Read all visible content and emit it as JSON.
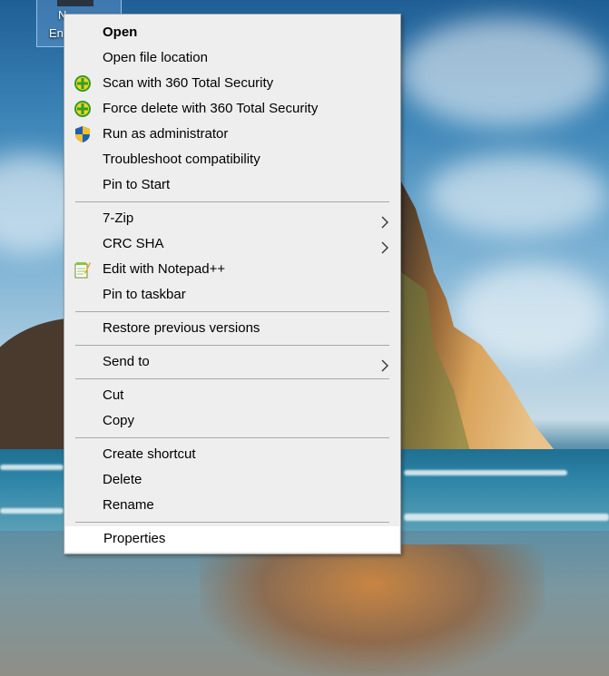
{
  "desktop": {
    "icon_label_line1": "N",
    "icon_label_line2": "En"
  },
  "context_menu": {
    "groups": [
      [
        {
          "label": "Open",
          "bold": true
        },
        {
          "label": "Open file location"
        },
        {
          "label": "Scan with 360 Total Security",
          "icon": "360-total-security-icon"
        },
        {
          "label": "Force delete with 360 Total Security",
          "icon": "360-total-security-icon"
        },
        {
          "label": "Run as administrator",
          "icon": "uac-shield-icon"
        },
        {
          "label": "Troubleshoot compatibility"
        },
        {
          "label": "Pin to Start"
        }
      ],
      [
        {
          "label": "7-Zip",
          "submenu": true
        },
        {
          "label": "CRC SHA",
          "submenu": true
        },
        {
          "label": "Edit with Notepad++",
          "icon": "notepad-plus-plus-icon"
        },
        {
          "label": "Pin to taskbar"
        }
      ],
      [
        {
          "label": "Restore previous versions"
        }
      ],
      [
        {
          "label": "Send to",
          "submenu": true
        }
      ],
      [
        {
          "label": "Cut"
        },
        {
          "label": "Copy"
        }
      ],
      [
        {
          "label": "Create shortcut"
        },
        {
          "label": "Delete"
        },
        {
          "label": "Rename"
        }
      ],
      [
        {
          "label": "Properties",
          "highlighted": true
        }
      ]
    ]
  },
  "colors": {
    "menu_background": "#eeeeee",
    "menu_border": "#a0a0a0",
    "separator": "#a8a8a8",
    "highlight": "#ffffff"
  }
}
